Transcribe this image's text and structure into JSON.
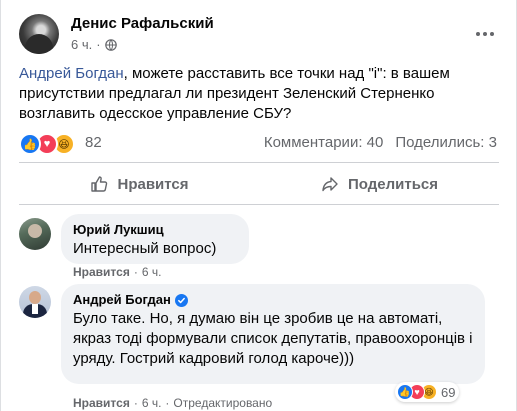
{
  "post": {
    "author": "Денис Рафальский",
    "time": "6 ч.",
    "text_mention": "Андрей Богдан",
    "text_body": ", можете расставить все точки над \"i\": в вашем присутствии предлагал ли президент Зеленский Стерненко возглавить одесское управление СБУ?",
    "reaction_count": "82",
    "comments_count": "Комментарии: 40",
    "shares_count": "Поделились: 3",
    "reactions": [
      "like",
      "love",
      "haha"
    ]
  },
  "actions": {
    "like_label": "Нравится",
    "share_label": "Поделиться"
  },
  "comments": [
    {
      "author": "Юрий Лукшиц",
      "text": "Интересный вопрос)",
      "like_label": "Нравится",
      "sep": "·",
      "time": "6 ч."
    },
    {
      "author": "Андрей Богдан",
      "verified": true,
      "text": "Було таке. Но, я думаю він це зробив це на автоматі, якраз тоді формували список депутатів, правоохоронців і уряду. Гострий кадровий голод кароче)))",
      "like_label": "Нравится",
      "sep": "·",
      "time": "6 ч.",
      "sep2": "·",
      "edited": "Отредактировано",
      "reaction_count": "69"
    }
  ],
  "colors": {
    "accent": "#1877f2",
    "mention": "#385898",
    "secondary_text": "#65676b",
    "bubble": "#f0f2f5"
  }
}
